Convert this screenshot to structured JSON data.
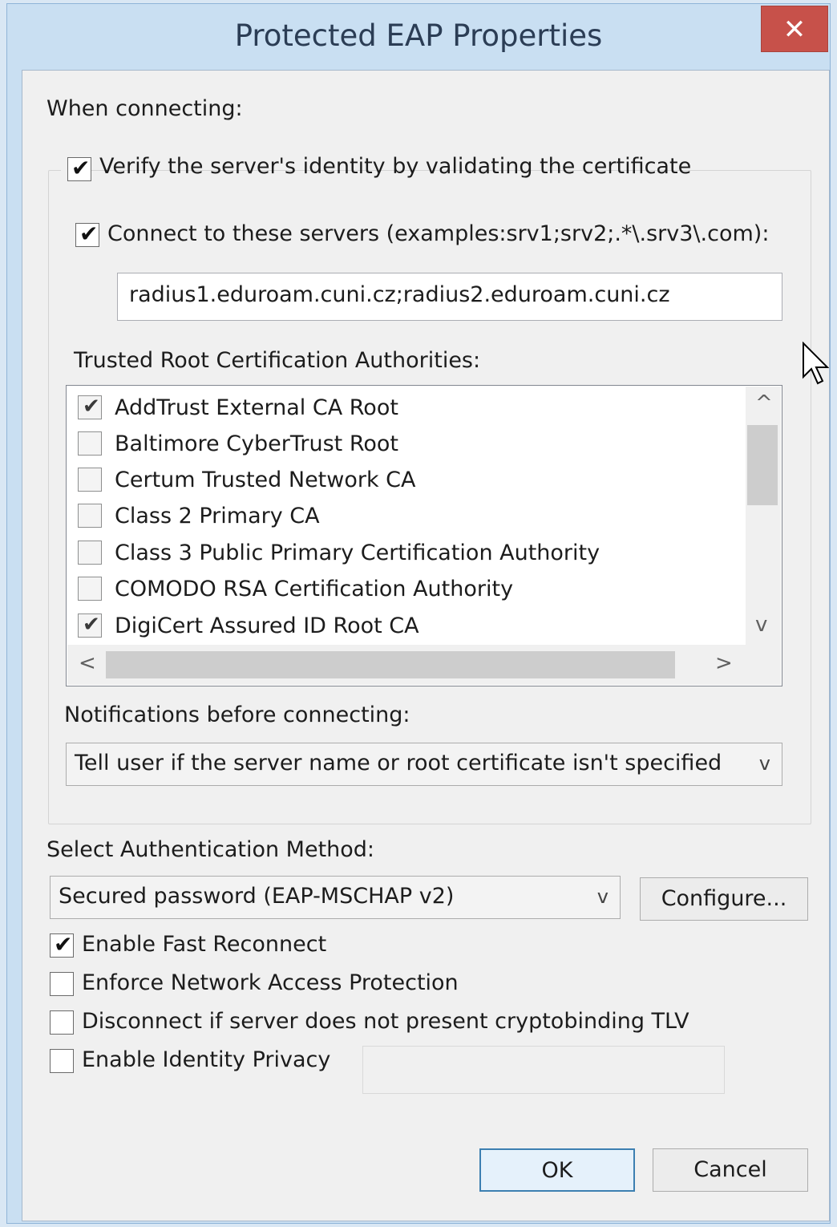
{
  "window": {
    "title": "Protected EAP Properties",
    "close_glyph": "✕"
  },
  "when_connecting_label": "When connecting:",
  "verify_identity": {
    "label": "Verify the server's identity by validating the certificate",
    "checked": true
  },
  "connect_servers": {
    "label": "Connect to these servers (examples:srv1;srv2;.*\\.srv3\\.com):",
    "checked": true
  },
  "servers_value": "radius1.eduroam.cuni.cz;radius2.eduroam.cuni.cz",
  "trusted_root_label": "Trusted Root Certification Authorities:",
  "trusted_roots": [
    {
      "label": "AddTrust External CA Root",
      "checked": true
    },
    {
      "label": "Baltimore CyberTrust Root",
      "checked": false
    },
    {
      "label": "Certum Trusted Network CA",
      "checked": false
    },
    {
      "label": "Class 2 Primary CA",
      "checked": false
    },
    {
      "label": "Class 3 Public Primary Certification Authority",
      "checked": false
    },
    {
      "label": "COMODO RSA Certification Authority",
      "checked": false
    },
    {
      "label": "DigiCert Assured ID Root CA",
      "checked": true
    }
  ],
  "notifications_label": "Notifications before connecting:",
  "notifications_value": "Tell user if the server name or root certificate isn't specified",
  "auth_method_label": "Select Authentication Method:",
  "auth_method_value": "Secured password (EAP-MSCHAP v2)",
  "configure_label": "Configure...",
  "options": [
    {
      "label": "Enable Fast Reconnect",
      "checked": true
    },
    {
      "label": "Enforce Network Access Protection",
      "checked": false
    },
    {
      "label": "Disconnect if server does not present cryptobinding TLV",
      "checked": false
    },
    {
      "label": "Enable Identity Privacy",
      "checked": false
    }
  ],
  "ok_label": "OK",
  "cancel_label": "Cancel",
  "check_glyph": "✔",
  "icons": {
    "scroll_up": "^",
    "scroll_down": "v",
    "scroll_left": "<",
    "scroll_right": ">",
    "dropdown": "v"
  }
}
